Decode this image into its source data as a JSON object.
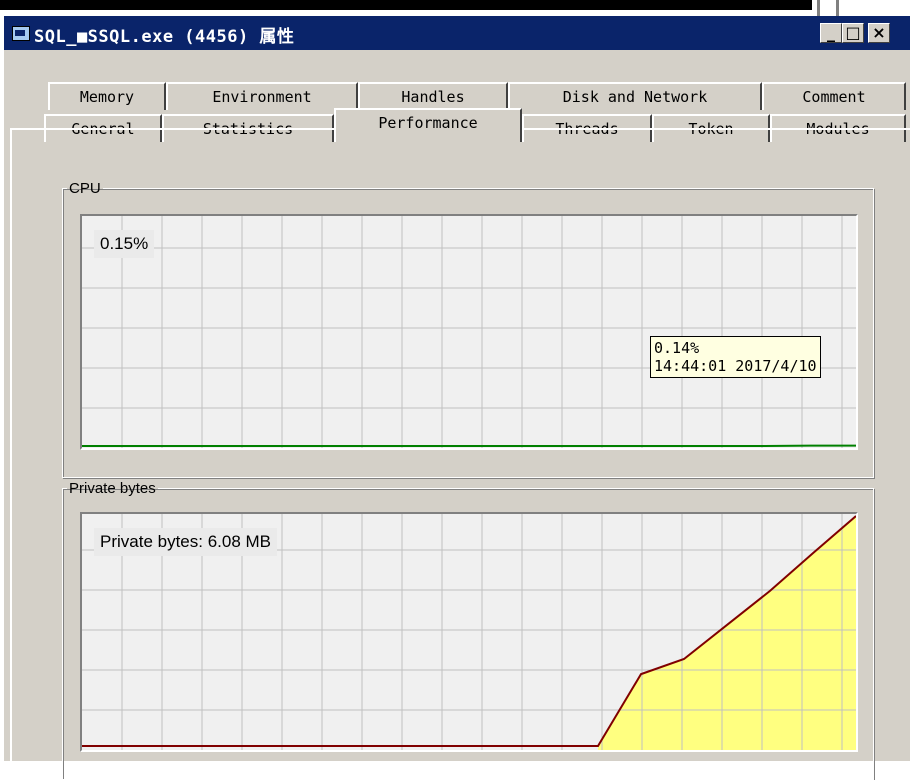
{
  "window": {
    "title": "SQL_■SSQL.exe (4456) 属性",
    "minimize_glyph": "_",
    "maximize_glyph": "□",
    "close_glyph": "×"
  },
  "tabs": {
    "row1": [
      "Memory",
      "Environment",
      "Handles",
      "Disk and Network",
      "Comment"
    ],
    "row2": [
      "General",
      "Statistics",
      "Performance",
      "Threads",
      "Token",
      "Modules"
    ],
    "active": "Performance"
  },
  "cpu": {
    "group_label": "CPU",
    "value_label": "0.15%",
    "line_color": "#008000",
    "history_percent": [
      0,
      0,
      0,
      0,
      0,
      0,
      0,
      0,
      0,
      0,
      0,
      0,
      0,
      0,
      0,
      0,
      0.14,
      0.15
    ]
  },
  "tooltip": {
    "value": "0.14%",
    "timestamp": "14:44:01 2017/4/10"
  },
  "private_bytes": {
    "group_label": "Private bytes",
    "value_label": "Private bytes: 6.08 MB",
    "line_color": "#800000",
    "fill_color": "#ffff80",
    "history_mb": [
      0,
      0,
      0,
      0,
      0,
      0,
      0,
      0,
      0,
      0,
      0,
      0,
      0,
      1.9,
      2.3,
      3.2,
      4.1,
      5.1,
      6.08
    ]
  }
}
